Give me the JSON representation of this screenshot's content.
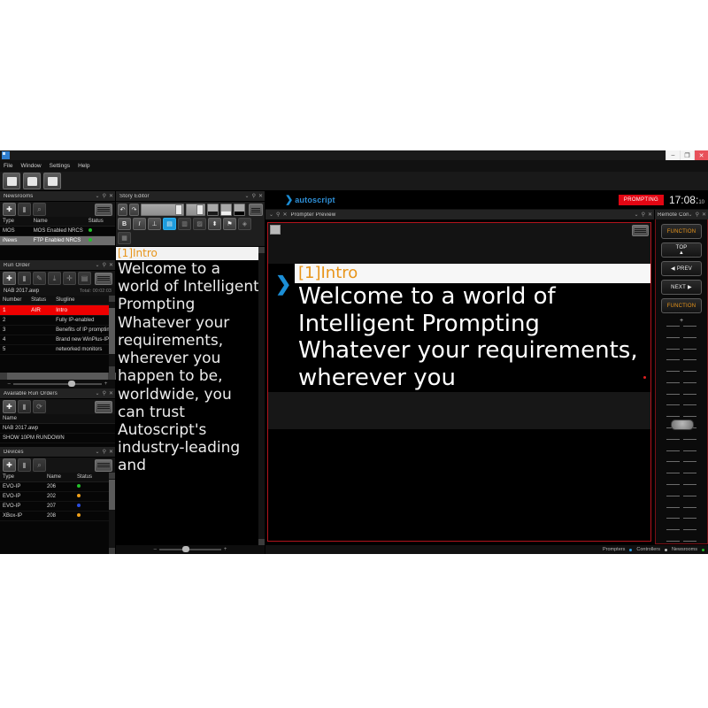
{
  "window": {
    "app_icon": "app-window-icon",
    "minimize_label": "–",
    "maximize_label": "❐",
    "close_label": "✕"
  },
  "menubar": {
    "items": [
      "File",
      "Window",
      "Settings",
      "Help"
    ]
  },
  "app_toolbar": {
    "buttons": [
      "new-document-icon",
      "open-folder-icon",
      "save-disk-icon"
    ]
  },
  "brand": {
    "chevron": "❯",
    "name": "autoscript",
    "status_badge": "PROMPTING",
    "clock": "17:08:",
    "clock_seconds": "10"
  },
  "newsrooms": {
    "title": "Newsrooms",
    "toolbar": [
      "add-icon",
      "delete-icon",
      "search-icon",
      "menu-icon"
    ],
    "columns": [
      "Type",
      "Name",
      "Status"
    ],
    "rows": [
      {
        "type": "MOS",
        "name": "MOS Enabled NRCS",
        "status_color": "#22c02a",
        "selected": false
      },
      {
        "type": "iNews",
        "name": "FTP Enabled NRCS",
        "status_color": "#22c02a",
        "selected": true
      }
    ]
  },
  "run_order": {
    "title": "Run Order",
    "toolbar": [
      "add-icon",
      "delete-icon",
      "edit-icon",
      "download-icon",
      "move-icon",
      "grid-icon",
      "menu-icon"
    ],
    "file_name": "NAB 2017.awp",
    "total_label": "Total: 00:02:03",
    "columns": [
      "Number",
      "Status",
      "Slugline"
    ],
    "rows": [
      {
        "number": "1",
        "status": "AIR",
        "slugline": "Intro",
        "on_air": true
      },
      {
        "number": "2",
        "status": "",
        "slugline": "Fully IP-enabled",
        "on_air": false
      },
      {
        "number": "3",
        "status": "",
        "slugline": "Benefits of IP prompting",
        "on_air": false
      },
      {
        "number": "4",
        "status": "",
        "slugline": "Brand new WinPlus-IP",
        "on_air": false
      },
      {
        "number": "5",
        "status": "",
        "slugline": "networked monitors",
        "on_air": false
      }
    ],
    "zoom_minus": "–",
    "zoom_plus": "+"
  },
  "available_run_orders": {
    "title": "Available Run Orders",
    "toolbar": [
      "add-icon",
      "delete-icon",
      "refresh-icon",
      "menu-icon"
    ],
    "columns": [
      "Name"
    ],
    "rows": [
      "NAB 2017.awp",
      "SHOW 10PM RUNDOWN"
    ]
  },
  "devices": {
    "title": "Devices",
    "toolbar": [
      "add-icon",
      "delete-icon",
      "search-icon",
      "menu-icon"
    ],
    "columns": [
      "Type",
      "Name",
      "Status"
    ],
    "rows": [
      {
        "type": "EVO-IP",
        "name": "206",
        "status_color": "#22c02a"
      },
      {
        "type": "EVO-IP",
        "name": "202",
        "status_color": "#f0a01a"
      },
      {
        "type": "EVO-IP",
        "name": "207",
        "status_color": "#2a4de0"
      },
      {
        "type": "XBox-IP",
        "name": "208",
        "status_color": "#f0a01a"
      }
    ]
  },
  "story_editor": {
    "title": "Story Editor",
    "toolbar_row1": [
      "undo-icon",
      "redo-icon",
      "font-family-combo",
      "font-size-combo",
      "text-color-swatch",
      "highlight-color-swatch",
      "background-color-swatch",
      "menu-icon"
    ],
    "toolbar_row2": [
      "bold-button",
      "italic-button",
      "underline-button",
      "presenter-text-button",
      "align-left-button",
      "align-right-button",
      "insert-cue-button",
      "insert-marker-button",
      "insert-symbol-button",
      "table-button"
    ],
    "bold_label": "B",
    "italic_label": "I",
    "heading": "[1]Intro",
    "body": "Welcome to a world of Intelligent Prompting Whatever your requirements, wherever you happen to be, worldwide, you can trust Autoscript's industry-leading and"
  },
  "prompter_preview": {
    "title": "Prompter Preview",
    "cue_marker": "❯",
    "heading": "[1]Intro",
    "body": "Welcome to a world of Intelligent Prompting Whatever your requirements, wherever you"
  },
  "remote_control": {
    "title": "Remote Control",
    "buttons": [
      {
        "label": "FUNCTION",
        "kind": "function"
      },
      {
        "label": "TOP",
        "kind": "top"
      },
      {
        "label": "PREV",
        "kind": "prev"
      },
      {
        "label": "NEXT",
        "kind": "next"
      },
      {
        "label": "FUNCTION",
        "kind": "function"
      }
    ],
    "slider_plus": "+"
  },
  "status_bar": {
    "items": [
      {
        "label": "Prompters",
        "color": "#2a9be0"
      },
      {
        "label": "Controllers",
        "color": "#bdbdbd"
      },
      {
        "label": "Newsrooms",
        "color": "#22c02a"
      }
    ]
  },
  "colors": {
    "accent_orange": "#e8951a",
    "brand_blue": "#2f90d8",
    "alert_red": "#e30613",
    "on_air_red": "#ee0000",
    "panel_border_red": "#b3141c"
  }
}
